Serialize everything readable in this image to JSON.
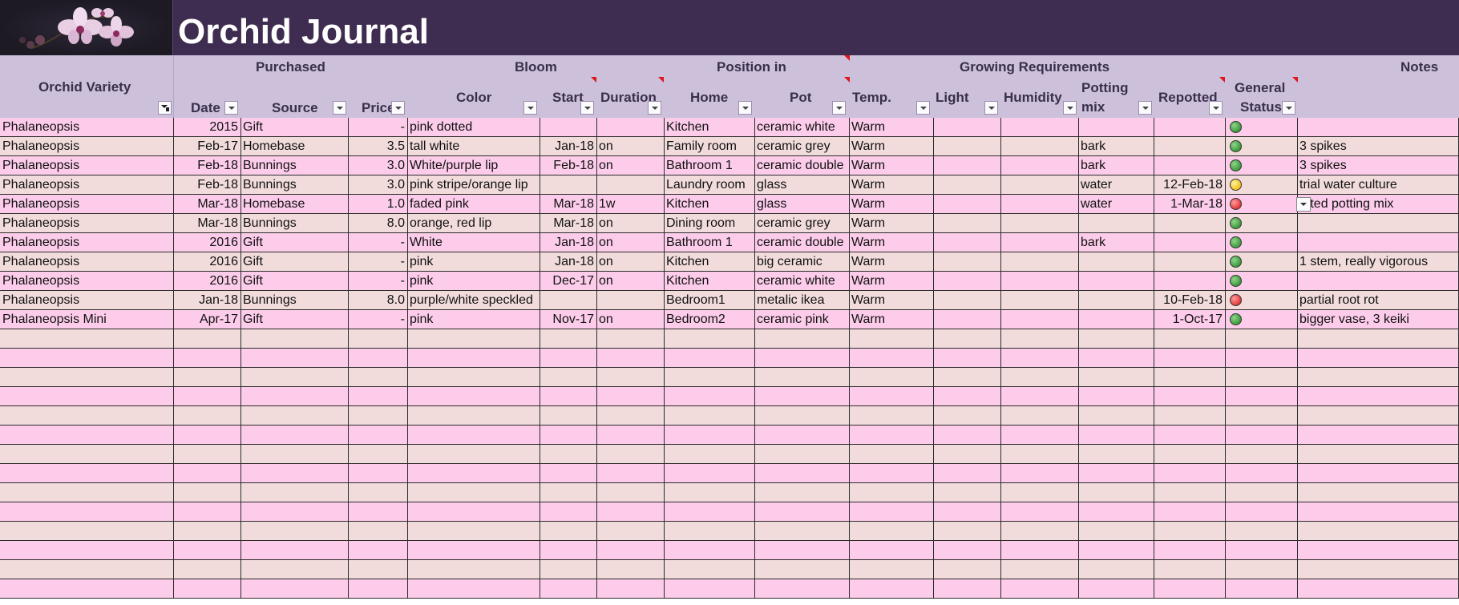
{
  "title": "Orchid Journal",
  "logo": {
    "icon": "orchid-flower-image"
  },
  "header": {
    "groups": {
      "purchased": "Purchased",
      "bloom": "Bloom",
      "position": "Position in",
      "growing": "Growing Requirements",
      "notes": "Notes"
    },
    "columns": {
      "variety": "Orchid Variety",
      "date": "Date",
      "source": "Source",
      "price": "Price",
      "color": "Color",
      "start": "Start",
      "duration": "Duration",
      "home": "Home",
      "pot": "Pot",
      "temp": "Temp.",
      "light": "Light",
      "humidity": "Humidity",
      "potting_line1": "Potting",
      "potting_line2": "mix",
      "repotted": "Repotted",
      "status_line1": "General",
      "status_line2": "Status"
    }
  },
  "colors": {
    "title_bg": "#3f2d51",
    "header_bg": "#ccc0da",
    "row_pink": "#fcccea",
    "row_beige": "#f1dcdb",
    "status_good": "#3c9a3c",
    "status_warn": "#f0c020",
    "status_bad": "#e03a3a"
  },
  "rows": [
    {
      "variety": "Phalaneopsis",
      "date": "2015",
      "source": "Gift",
      "price": "-",
      "color": "pink dotted",
      "start": "",
      "duration": "",
      "home": "Kitchen",
      "pot": "ceramic white",
      "temp": "Warm",
      "light": "",
      "humidity": "",
      "potting": "",
      "repotted": "",
      "status": "good",
      "notes": ""
    },
    {
      "variety": "Phalaneopsis",
      "date": "Feb-17",
      "source": "Homebase",
      "price": "3.5",
      "color": "tall white",
      "start": "Jan-18",
      "duration": "on",
      "home": "Family room",
      "pot": "ceramic grey",
      "temp": "Warm",
      "light": "",
      "humidity": "",
      "potting": "bark",
      "repotted": "",
      "status": "good",
      "notes": "3 spikes"
    },
    {
      "variety": "Phalaneopsis",
      "date": "Feb-18",
      "source": "Bunnings",
      "price": "3.0",
      "color": "White/purple lip",
      "start": "Feb-18",
      "duration": "on",
      "home": "Bathroom 1",
      "pot": "ceramic double",
      "temp": "Warm",
      "light": "",
      "humidity": "",
      "potting": "bark",
      "repotted": "",
      "status": "good",
      "notes": "3 spikes"
    },
    {
      "variety": "Phalaneopsis",
      "date": "Feb-18",
      "source": "Bunnings",
      "price": "3.0",
      "color": "pink stripe/orange lip",
      "start": "",
      "duration": "",
      "home": "Laundry room",
      "pot": "glass",
      "temp": "Warm",
      "light": "",
      "humidity": "",
      "potting": "water",
      "repotted": "12-Feb-18",
      "status": "warn",
      "notes": "trial water culture"
    },
    {
      "variety": "Phalaneopsis",
      "date": "Mar-18",
      "source": "Homebase",
      "price": "1.0",
      "color": "faded pink",
      "start": "Mar-18",
      "duration": "1w",
      "home": "Kitchen",
      "pot": "glass",
      "temp": "Warm",
      "light": "",
      "humidity": "",
      "potting": "water",
      "repotted": "1-Mar-18",
      "status": "bad",
      "notes": "otted potting mix"
    },
    {
      "variety": "Phalaneopsis",
      "date": "Mar-18",
      "source": "Bunnings",
      "price": "8.0",
      "color": "orange, red lip",
      "start": "Mar-18",
      "duration": "on",
      "home": "Dining room",
      "pot": "ceramic grey",
      "temp": "Warm",
      "light": "",
      "humidity": "",
      "potting": "",
      "repotted": "",
      "status": "good",
      "notes": ""
    },
    {
      "variety": "Phalaneopsis",
      "date": "2016",
      "source": "Gift",
      "price": "-",
      "color": "White",
      "start": "Jan-18",
      "duration": "on",
      "home": "Bathroom 1",
      "pot": "ceramic double",
      "temp": "Warm",
      "light": "",
      "humidity": "",
      "potting": "bark",
      "repotted": "",
      "status": "good",
      "notes": ""
    },
    {
      "variety": "Phalaneopsis",
      "date": "2016",
      "source": "Gift",
      "price": "-",
      "color": "pink",
      "start": "Jan-18",
      "duration": "on",
      "home": "Kitchen",
      "pot": "big ceramic",
      "temp": "Warm",
      "light": "",
      "humidity": "",
      "potting": "",
      "repotted": "",
      "status": "good",
      "notes": "1 stem, really vigorous"
    },
    {
      "variety": "Phalaneopsis",
      "date": "2016",
      "source": "Gift",
      "price": "-",
      "color": "pink",
      "start": "Dec-17",
      "duration": "on",
      "home": "Kitchen",
      "pot": "ceramic white",
      "temp": "Warm",
      "light": "",
      "humidity": "",
      "potting": "",
      "repotted": "",
      "status": "good",
      "notes": ""
    },
    {
      "variety": "Phalaneopsis",
      "date": "Jan-18",
      "source": "Bunnings",
      "price": "8.0",
      "color": "purple/white speckled",
      "start": "",
      "duration": "",
      "home": "Bedroom1",
      "pot": "metalic ikea",
      "temp": "Warm",
      "light": "",
      "humidity": "",
      "potting": "",
      "repotted": "10-Feb-18",
      "status": "bad",
      "notes": "partial root rot"
    },
    {
      "variety": "Phalaneopsis Mini",
      "date": "Apr-17",
      "source": "Gift",
      "price": "-",
      "color": "pink",
      "start": "Nov-17",
      "duration": "on",
      "home": "Bedroom2",
      "pot": "ceramic pink",
      "temp": "Warm",
      "light": "",
      "humidity": "",
      "potting": "",
      "repotted": "1-Oct-17",
      "status": "good",
      "notes": "bigger vase, 3 keiki"
    }
  ]
}
